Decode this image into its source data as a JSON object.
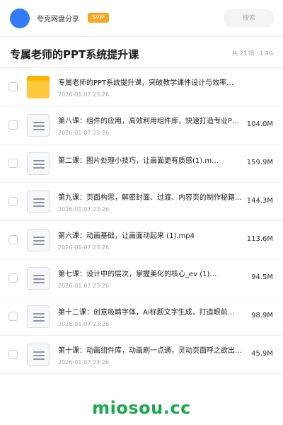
{
  "header": {
    "username": "夸克网盘分享",
    "badge": "SVIP",
    "search_placeholder": "搜索",
    "brand_color": "#2f7cf6"
  },
  "folder": {
    "title": "专属老师的PPT系统提升课",
    "summary": "共 23 项 · 1.8G"
  },
  "files": [
    {
      "icon": "folder-icon",
      "name": "专属老师的PPT系统提升课，突破教学课件设计与效率…",
      "date": "2026-01-07 23:26",
      "size": ""
    },
    {
      "icon": "document-icon",
      "name": "第八课：组件的应用，高效利用组件库，快速打造专业P…",
      "date": "2026-01-07 23:26",
      "size": "104.0M"
    },
    {
      "icon": "document-icon",
      "name": "第二课：图片处理小技巧，让画面更有质感(1).m…",
      "date": "2026-01-07 23:26",
      "size": "159.9M"
    },
    {
      "icon": "document-icon",
      "name": "第九课：页面构思，解密封面、过渡、内容页的制作秘籍…",
      "date": "2026-01-07 23:26",
      "size": "144.3M"
    },
    {
      "icon": "document-icon",
      "name": "第六课：动画基础，让画面动起来 (1).mp4",
      "date": "2026-01-07 23:26",
      "size": "113.6M"
    },
    {
      "icon": "document-icon",
      "name": "第七课：设计中的层次，掌握美化的核心_ev (1)…",
      "date": "2026-01-07 23:26",
      "size": "94.5M"
    },
    {
      "icon": "document-icon",
      "name": "第十二课：创意吸睛字体，Ai标题文字生成，打造眼前…",
      "date": "2026-01-07 23:26",
      "size": "98.9M"
    },
    {
      "icon": "document-icon",
      "name": "第十课：动画组件库，动画刷一点通，灵动页面呼之欲出…",
      "date": "2026-01-07 23:26",
      "size": "45.9M"
    }
  ],
  "watermark": "miosou.cc"
}
